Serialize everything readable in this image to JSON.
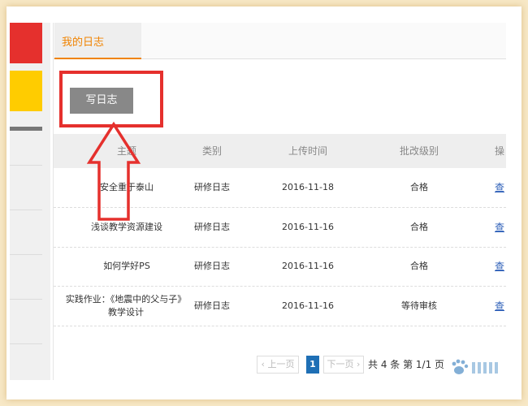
{
  "tabs": {
    "my_log": "我的日志"
  },
  "toolbar": {
    "write_log": "写日志"
  },
  "table": {
    "headers": [
      "主题",
      "类别",
      "上传时间",
      "批改级别",
      "操"
    ],
    "rows": [
      {
        "topic": "安全重于泰山",
        "category": "研修日志",
        "time": "2016-11-18",
        "grade": "合格",
        "action": "查"
      },
      {
        "topic": "浅谈教学资源建设",
        "category": "研修日志",
        "time": "2016-11-16",
        "grade": "合格",
        "action": "查"
      },
      {
        "topic": "如何学好PS",
        "category": "研修日志",
        "time": "2016-11-16",
        "grade": "合格",
        "action": "查"
      },
      {
        "topic_line1": "实践作业：《地震中的父与子》",
        "topic_line2": "教学设计",
        "category": "研修日志",
        "time": "2016-11-16",
        "grade": "等待审核",
        "action": "查"
      }
    ]
  },
  "pagination": {
    "prev": "‹ 上一页",
    "current": "1",
    "next": "下一页 ›",
    "summary": "共 4 条 第 1/1 页"
  },
  "colors": {
    "accent_orange": "#f08300",
    "annotation_red": "#e5302d",
    "link_blue": "#2d5fb8"
  }
}
